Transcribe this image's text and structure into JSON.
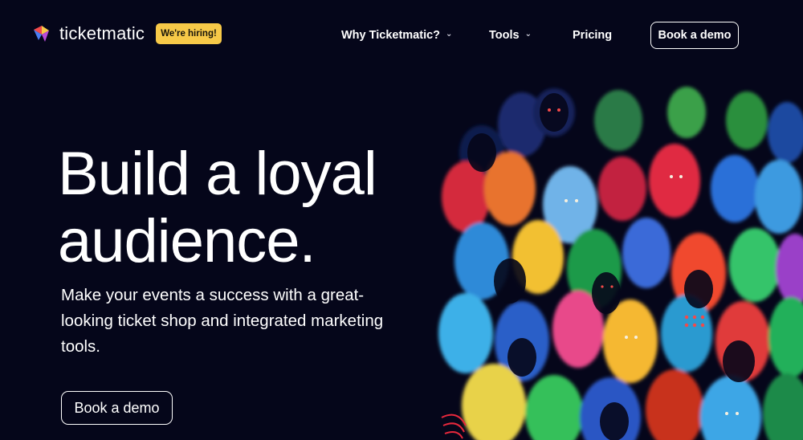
{
  "brand": {
    "name": "ticketmatic",
    "hiring_badge": "We're hiring!",
    "colors": {
      "background": "#05061a",
      "badge": "#f7c948"
    }
  },
  "nav": {
    "items": [
      {
        "label": "Why Ticketmatic?",
        "has_dropdown": true
      },
      {
        "label": "Tools",
        "has_dropdown": true
      },
      {
        "label": "Pricing",
        "has_dropdown": false
      }
    ],
    "cta_label": "Book a demo"
  },
  "hero": {
    "title_line1": "Build a loyal",
    "title_line2": "audience.",
    "subtitle": "Make your events a success with a great-looking ticket shop and integrated marketing tools.",
    "cta_label": "Book a demo"
  },
  "icons": {
    "logo": "ticketmatic-logo-icon",
    "dropdown": "chevron-down-icon"
  }
}
